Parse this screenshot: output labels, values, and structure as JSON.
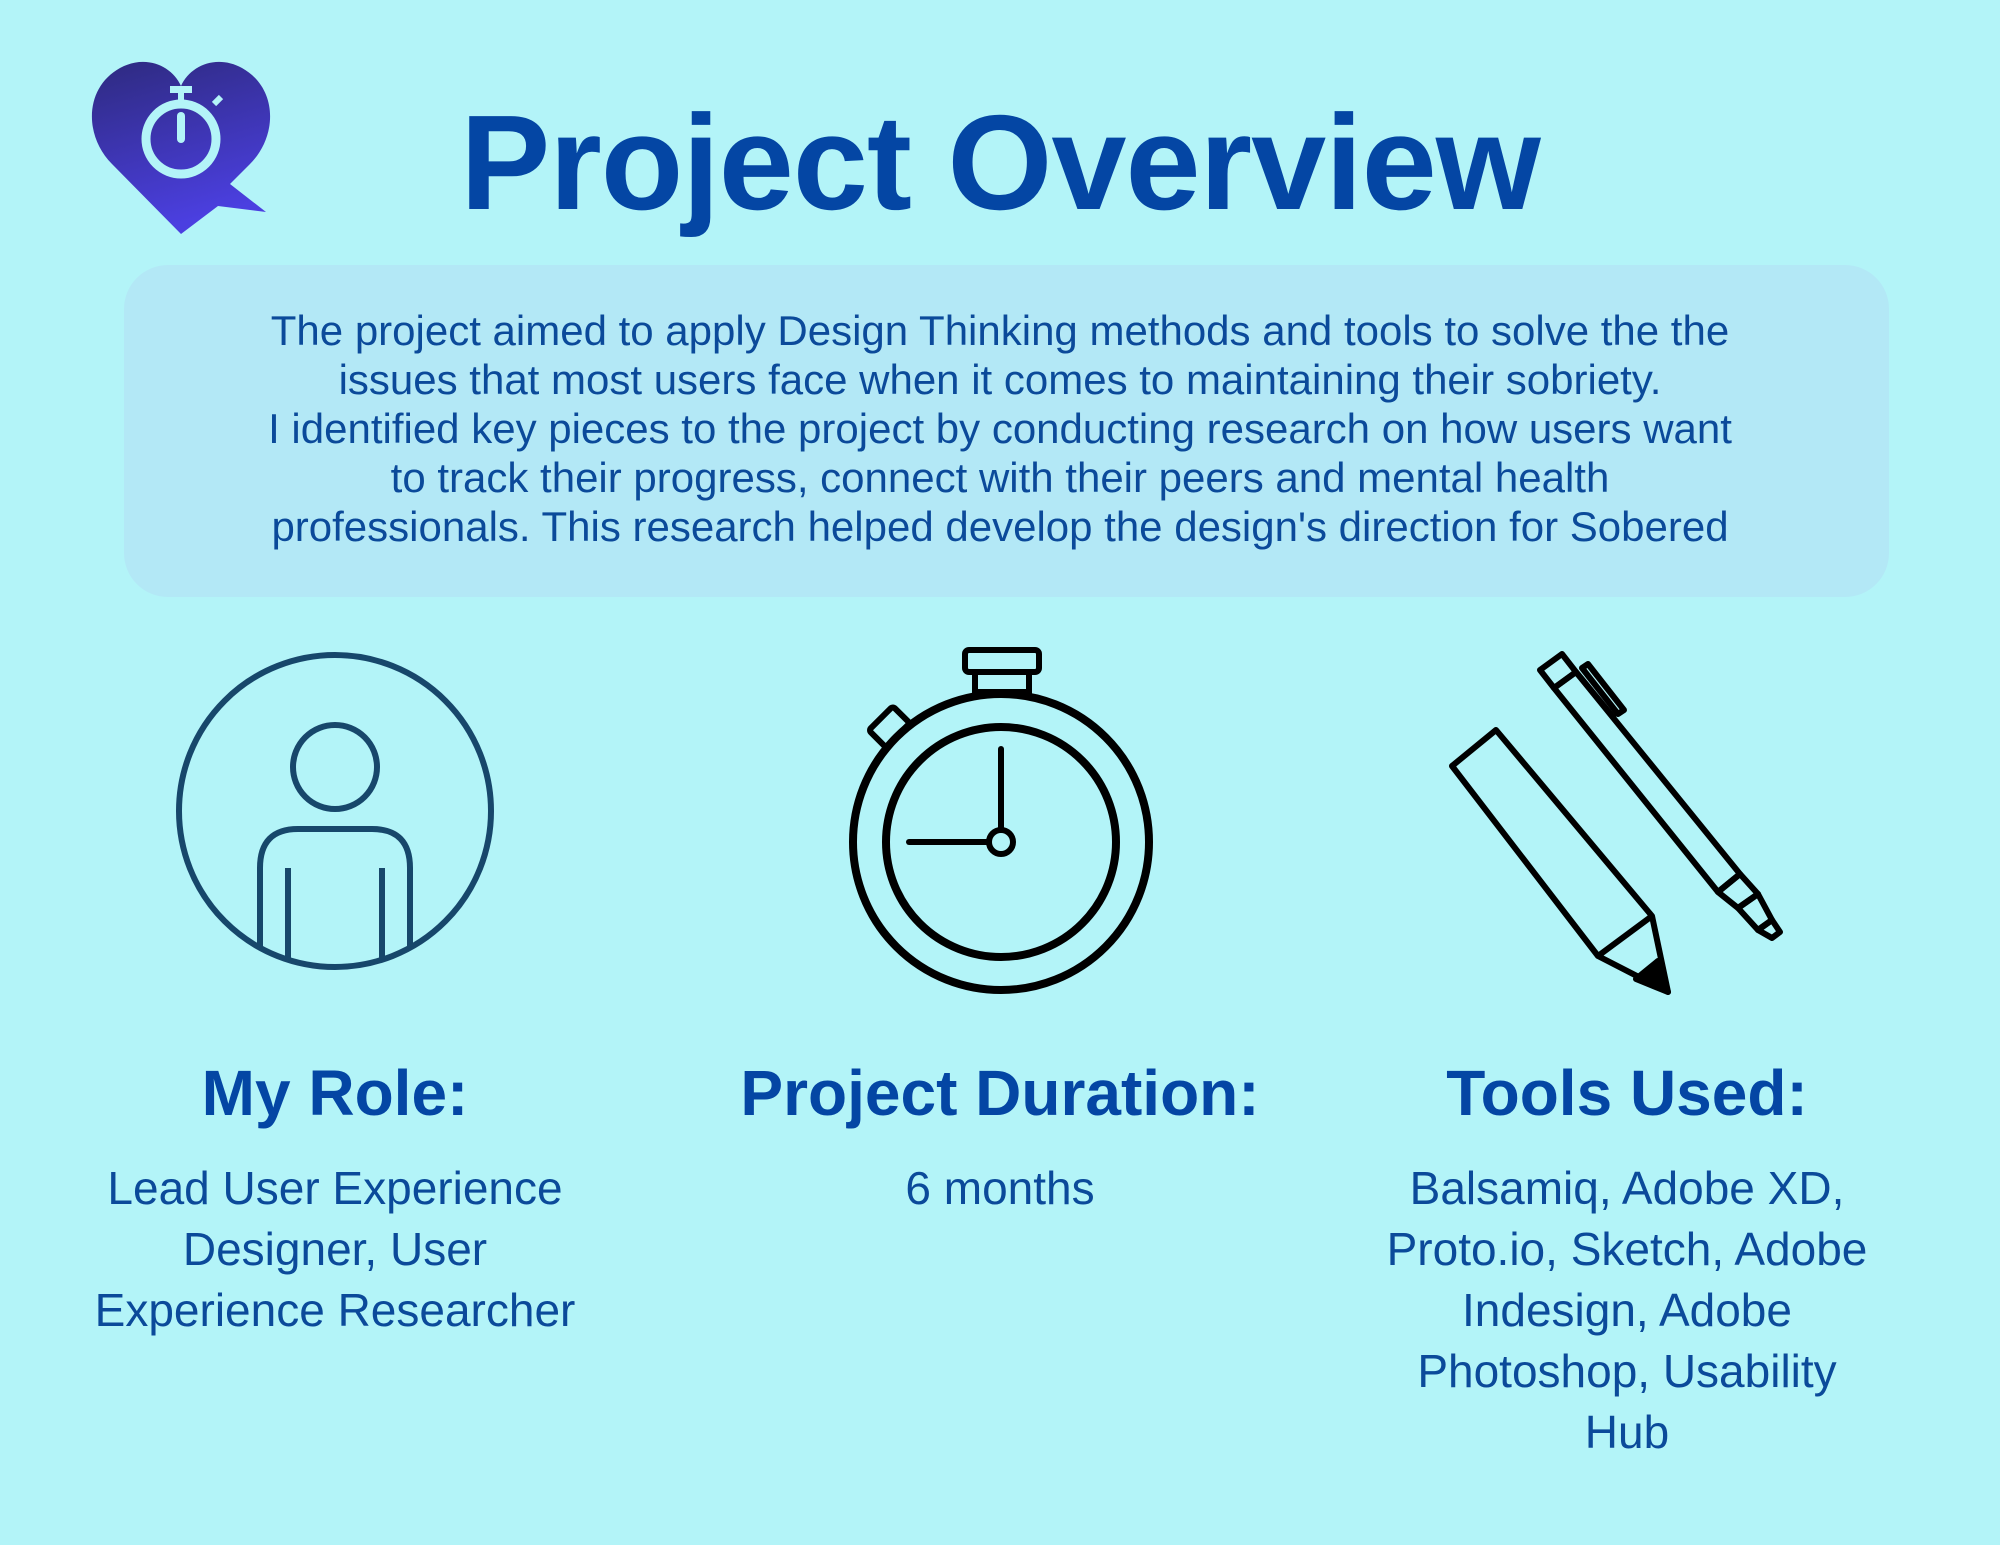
{
  "page": {
    "background_color": "#b3f4f8",
    "accent_color": "#0446a4"
  },
  "logo": {
    "icon": "heart-stopwatch-logo",
    "gradient_colors": [
      "#2e2a7f",
      "#4b3fe0"
    ]
  },
  "header": {
    "title": "Project Overview"
  },
  "intro": {
    "lines": [
      "The project aimed to apply Design Thinking methods and tools to solve the the",
      "issues that most users face when it comes to maintaining their sobriety.",
      "I identified key pieces to the project by conducting research on how users want",
      "to track their progress,  connect with their peers and mental health",
      "professionals. This research helped develop the design's direction for Sobered"
    ]
  },
  "cards": [
    {
      "icon": "person-in-circle-icon",
      "heading": "My Role:",
      "body_lines": [
        "Lead User Experience",
        "Designer, User",
        "Experience Researcher"
      ]
    },
    {
      "icon": "stopwatch-icon",
      "heading": "Project Duration:",
      "body_lines": [
        "6 months"
      ]
    },
    {
      "icon": "marker-and-pen-icon",
      "heading": "Tools Used:",
      "body_lines": [
        "Balsamiq, Adobe XD,",
        "Proto.io, Sketch, Adobe",
        "Indesign, Adobe",
        "Photoshop, Usability",
        "Hub"
      ]
    }
  ]
}
